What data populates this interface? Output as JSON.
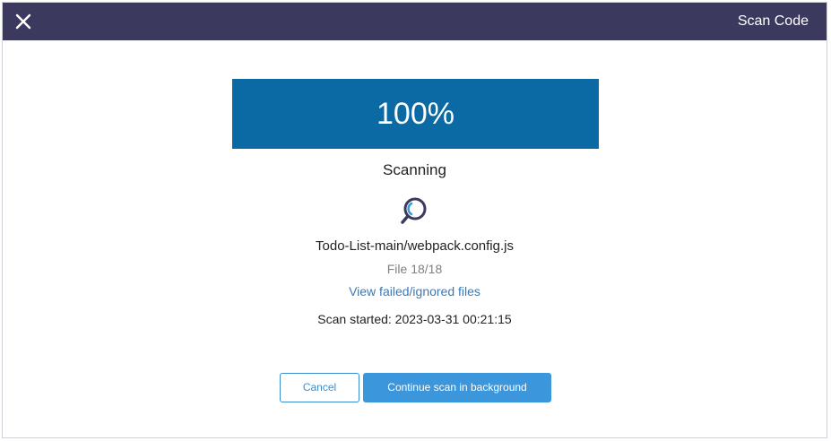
{
  "header": {
    "title": "Scan Code",
    "close_icon": "close-icon"
  },
  "progress": {
    "label": "100%",
    "fraction": 1.0
  },
  "scan": {
    "status": "Scanning",
    "icon": "scan-search-icon",
    "current_file": "Todo-List-main/webpack.config.js",
    "file_count": "File 18/18",
    "failed_link": "View failed/ignored files",
    "started": "Scan started: 2023-03-31 00:21:15"
  },
  "buttons": {
    "cancel": "Cancel",
    "continue": "Continue scan in background"
  },
  "colors": {
    "header_bg": "#3b3a5e",
    "progress_fill": "#0b69a3",
    "link": "#3b79b6",
    "primary_button": "#3b96db",
    "icon": "#3b3a5e"
  }
}
